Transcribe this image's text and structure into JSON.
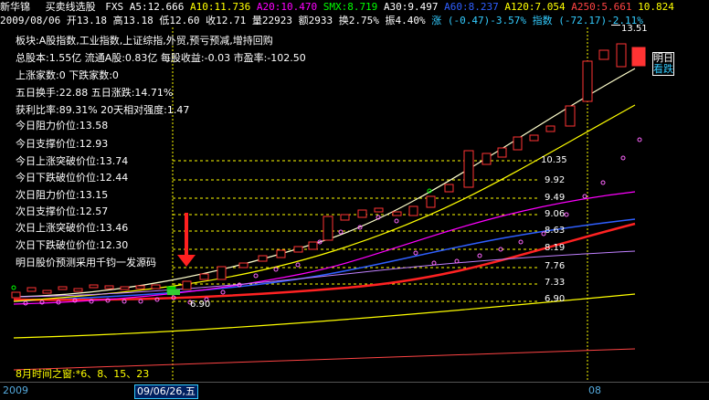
{
  "header": {
    "stock_name": "新华锦",
    "indicator_name": "买卖线选股",
    "fxs_label": "FXS",
    "a5": "A5:12.666",
    "a10": "A10:11.736",
    "a20": "A20:10.470",
    "smx": "SMX:8.719",
    "a30": "A30:9.497",
    "a60": "A60:8.237",
    "a120": "A120:7.054",
    "a250": "A250:5.661",
    "last": "10.824",
    "colors": {
      "stock_name": "#ffffff",
      "a5": "#ffffff",
      "a10": "#ffff00",
      "a20": "#ff00ff",
      "smx": "#00ff00",
      "a30": "#ffffff",
      "a60": "#2f5fff",
      "a120": "#ffff00",
      "a250": "#ff4444",
      "last": "#ffff00"
    }
  },
  "price_row": {
    "date": "2009/08/06",
    "open": "开13.18",
    "high": "高13.18",
    "low": "低12.60",
    "close": "收12.71",
    "volume": "量22923",
    "amount": "额2933",
    "turnover": "换2.75%",
    "amplitude": "振4.40%",
    "change": "涨 (-0.47)-3.57%",
    "index": "指数 (-72.17)-2.11%"
  },
  "info_lines": [
    "板块:A股指数,工业指数,上证综指,外贸,预亏预减,增持回购",
    "总股本:1.55亿  流通A股:0.83亿   每股收益:-0.03 市盈率:-102.50",
    "上涨家数:0     下跌家数:0",
    "五日换手:22.88  五日涨跌:14.71%",
    "获利比率:89.31%  20天相对强度:1.47",
    "今日阻力价位:13.58",
    "今日支撑价位:12.93",
    "今日上涨突破价位:13.74",
    "今日下跌破位价位:12.44",
    "次日阻力价位:13.15",
    "次日支撑价位:12.57",
    "次日上涨突破价位:13.46",
    "次日下跌破位价位:12.30",
    "明日股价预测采用千钧一发源码"
  ],
  "level_labels": [
    "10.35",
    "9.92",
    "9.49",
    "9.06",
    "8.63",
    "8.19",
    "7.76",
    "7.33",
    "6.90"
  ],
  "price_marks": {
    "high_label": "13.51",
    "low_label": "6.90"
  },
  "side_button": {
    "line1": "明日",
    "line2": "看跌"
  },
  "window_text": "8月时间之窗:*6、8、15、23",
  "bottom": {
    "year": "2009",
    "cursor_date": "09/06/26,五",
    "month": "08"
  }
}
